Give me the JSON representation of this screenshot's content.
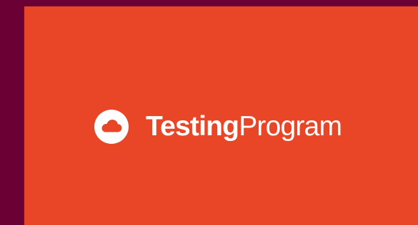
{
  "app": {
    "name_bold": "Testing",
    "name_regular": "Program",
    "logo_icon": "cloud-icon",
    "colors": {
      "window_background": "#6b0035",
      "splash_background": "#e94627",
      "foreground": "#ffffff"
    }
  }
}
